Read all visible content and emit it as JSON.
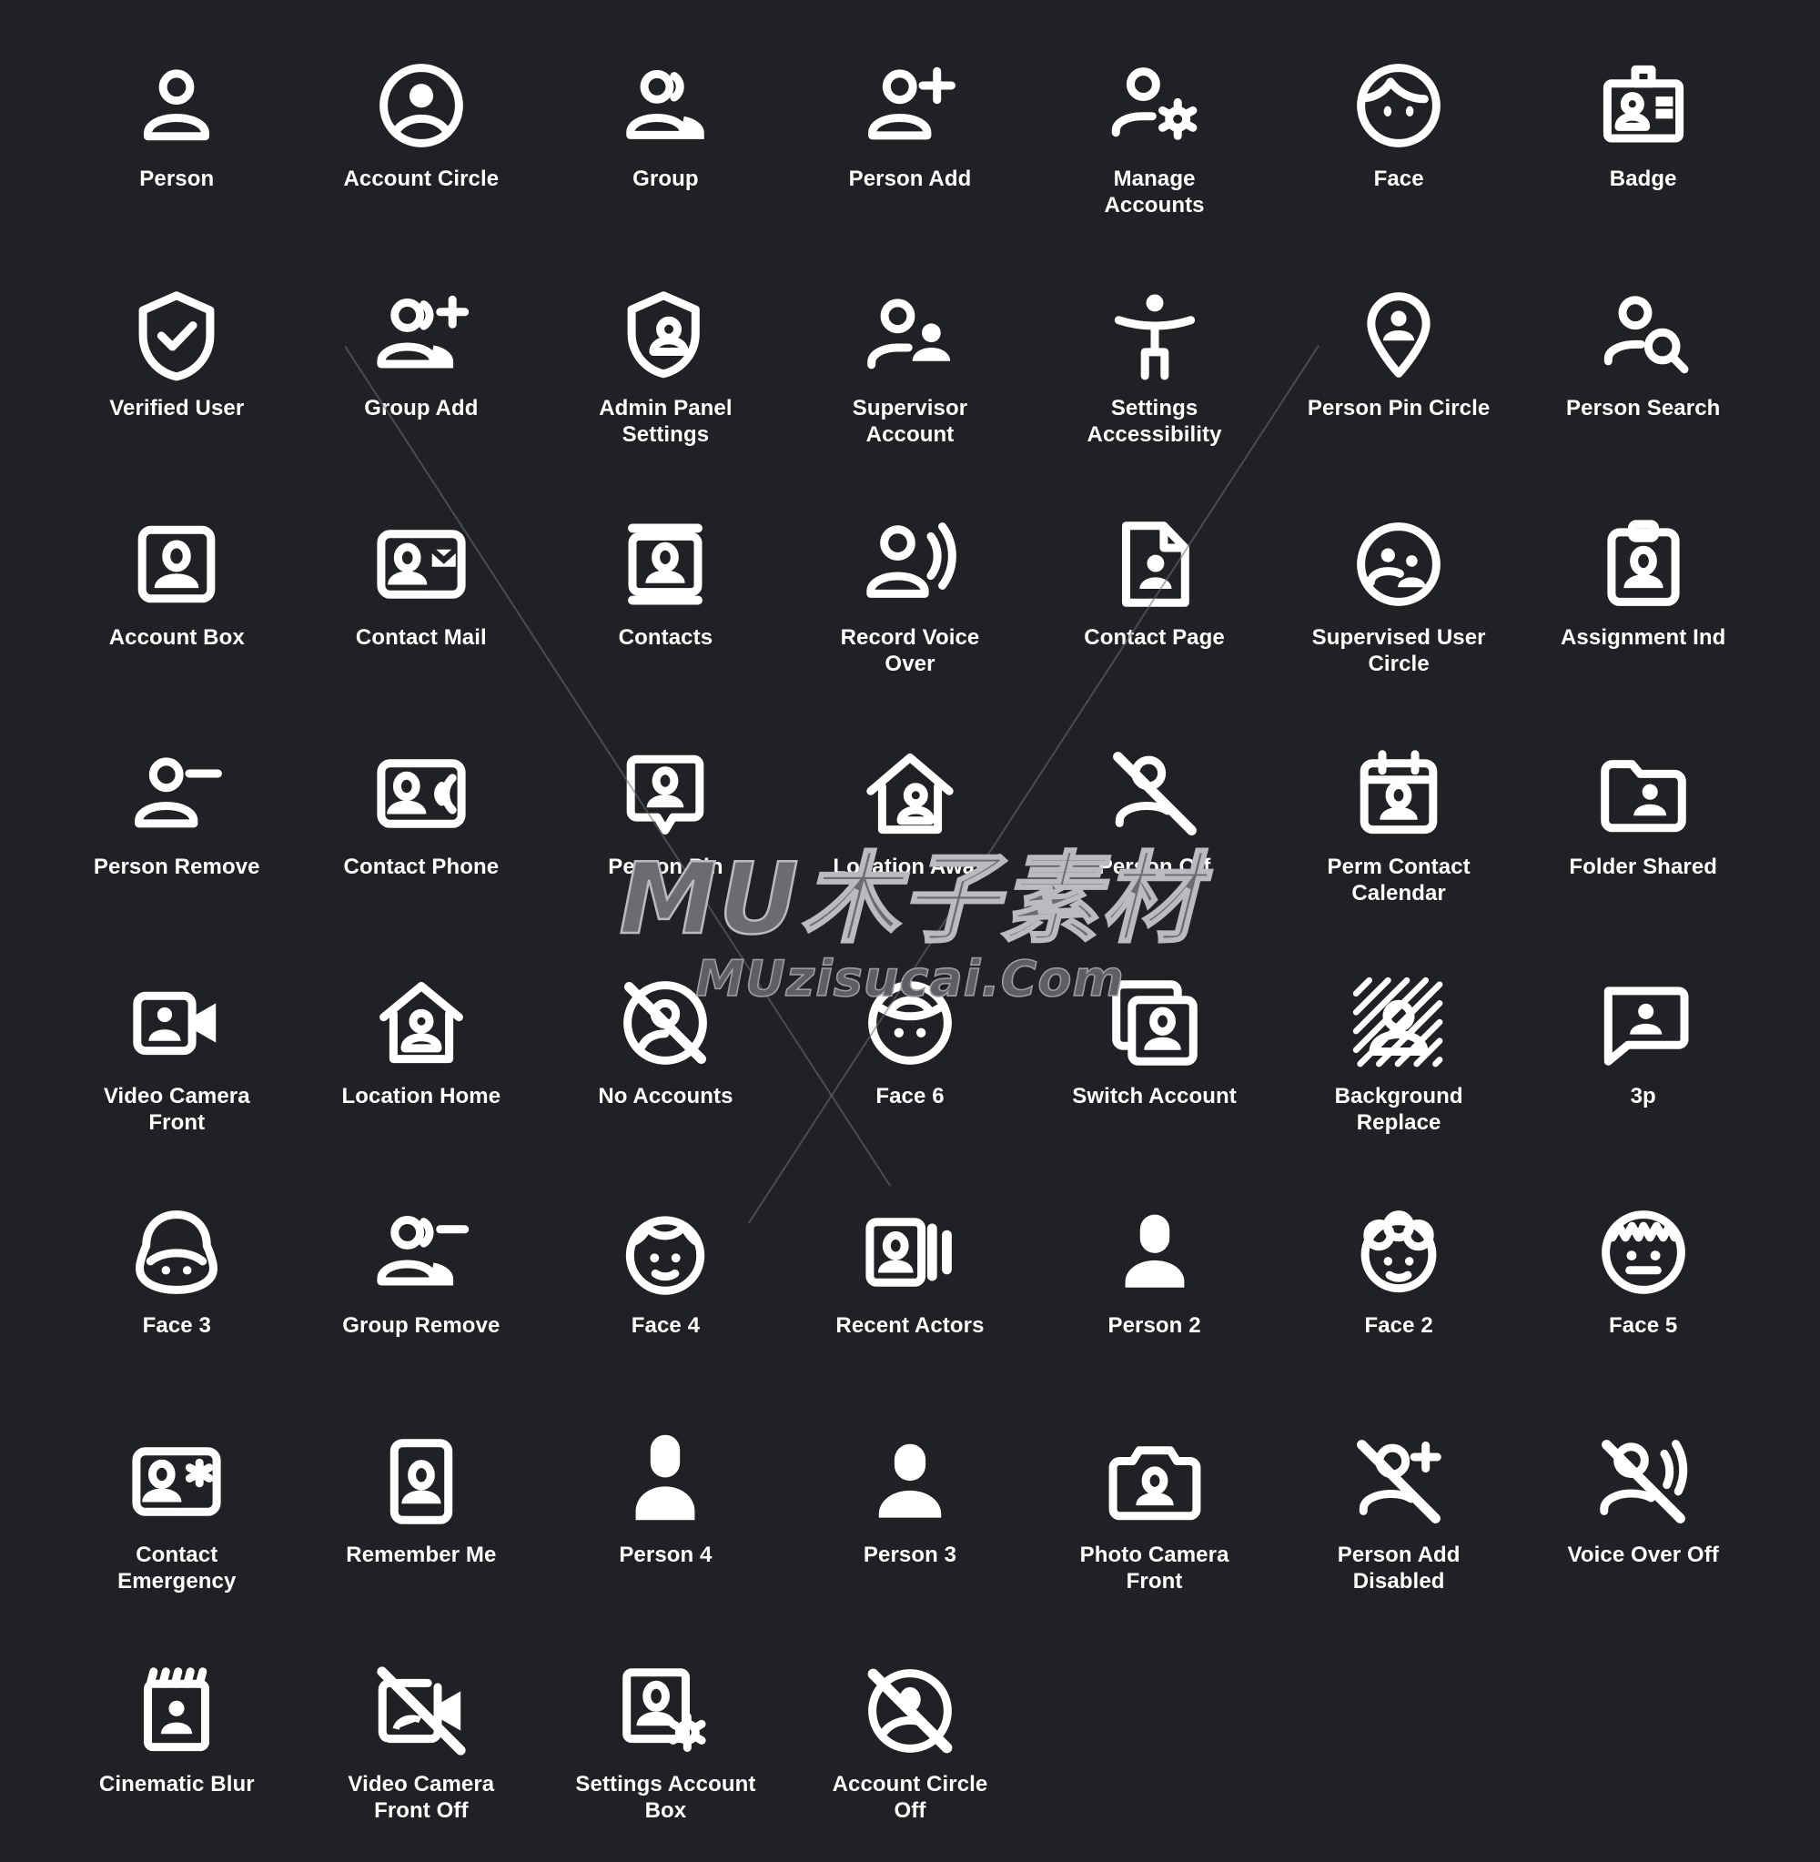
{
  "page": {
    "background_color": "#202124",
    "icon_color": "#ffffff",
    "label_color": "#ffffff",
    "columns": 7,
    "rows": 8,
    "total_icons": 53
  },
  "watermark": {
    "main_text": "MU木子素材",
    "sub_text": "MUzisucai.Com",
    "color": "#6a6c70"
  },
  "icons": [
    {
      "label": "Person",
      "name": "person-icon"
    },
    {
      "label": "Account Circle",
      "name": "account-circle-icon"
    },
    {
      "label": "Group",
      "name": "group-icon"
    },
    {
      "label": "Person Add",
      "name": "person-add-icon"
    },
    {
      "label": "Manage\nAccounts",
      "name": "manage-accounts-icon"
    },
    {
      "label": "Face",
      "name": "face-icon"
    },
    {
      "label": "Badge",
      "name": "badge-icon"
    },
    {
      "label": "Verified User",
      "name": "verified-user-icon"
    },
    {
      "label": "Group Add",
      "name": "group-add-icon"
    },
    {
      "label": "Admin Panel\nSettings",
      "name": "admin-panel-settings-icon"
    },
    {
      "label": "Supervisor\nAccount",
      "name": "supervisor-account-icon"
    },
    {
      "label": "Settings\nAccessibility",
      "name": "settings-accessibility-icon"
    },
    {
      "label": "Person Pin Circle",
      "name": "person-pin-circle-icon"
    },
    {
      "label": "Person Search",
      "name": "person-search-icon"
    },
    {
      "label": "Account Box",
      "name": "account-box-icon"
    },
    {
      "label": "Contact Mail",
      "name": "contact-mail-icon"
    },
    {
      "label": "Contacts",
      "name": "contacts-icon"
    },
    {
      "label": "Record Voice\nOver",
      "name": "record-voice-over-icon"
    },
    {
      "label": "Contact Page",
      "name": "contact-page-icon"
    },
    {
      "label": "Supervised User\nCircle",
      "name": "supervised-user-circle-icon"
    },
    {
      "label": "Assignment Ind",
      "name": "assignment-ind-icon"
    },
    {
      "label": "Person Remove",
      "name": "person-remove-icon"
    },
    {
      "label": "Contact Phone",
      "name": "contact-phone-icon"
    },
    {
      "label": "Person Pin",
      "name": "person-pin-icon"
    },
    {
      "label": "Location Away",
      "name": "location-away-icon"
    },
    {
      "label": "Person Off",
      "name": "person-off-icon"
    },
    {
      "label": "Perm Contact\nCalendar",
      "name": "perm-contact-calendar-icon"
    },
    {
      "label": "Folder Shared",
      "name": "folder-shared-icon"
    },
    {
      "label": "Video Camera\nFront",
      "name": "video-camera-front-icon"
    },
    {
      "label": "Location Home",
      "name": "location-home-icon"
    },
    {
      "label": "No Accounts",
      "name": "no-accounts-icon"
    },
    {
      "label": "Face 6",
      "name": "face-6-icon"
    },
    {
      "label": "Switch Account",
      "name": "switch-account-icon"
    },
    {
      "label": "Background\nReplace",
      "name": "background-replace-icon"
    },
    {
      "label": "3p",
      "name": "3p-icon"
    },
    {
      "label": "Face 3",
      "name": "face-3-icon"
    },
    {
      "label": "Group Remove",
      "name": "group-remove-icon"
    },
    {
      "label": "Face 4",
      "name": "face-4-icon"
    },
    {
      "label": "Recent Actors",
      "name": "recent-actors-icon"
    },
    {
      "label": "Person 2",
      "name": "person-2-icon"
    },
    {
      "label": "Face 2",
      "name": "face-2-icon"
    },
    {
      "label": "Face 5",
      "name": "face-5-icon"
    },
    {
      "label": "Contact\nEmergency",
      "name": "contact-emergency-icon"
    },
    {
      "label": "Remember Me",
      "name": "remember-me-icon"
    },
    {
      "label": "Person 4",
      "name": "person-4-icon"
    },
    {
      "label": "Person 3",
      "name": "person-3-icon"
    },
    {
      "label": "Photo Camera\nFront",
      "name": "photo-camera-front-icon"
    },
    {
      "label": "Person Add\nDisabled",
      "name": "person-add-disabled-icon"
    },
    {
      "label": "Voice Over Off",
      "name": "voice-over-off-icon"
    },
    {
      "label": "Cinematic Blur",
      "name": "cinematic-blur-icon"
    },
    {
      "label": "Video Camera\nFront Off",
      "name": "video-camera-front-off-icon"
    },
    {
      "label": "Settings Account\nBox",
      "name": "settings-account-box-icon"
    },
    {
      "label": "Account Circle\nOff",
      "name": "account-circle-off-icon"
    }
  ]
}
